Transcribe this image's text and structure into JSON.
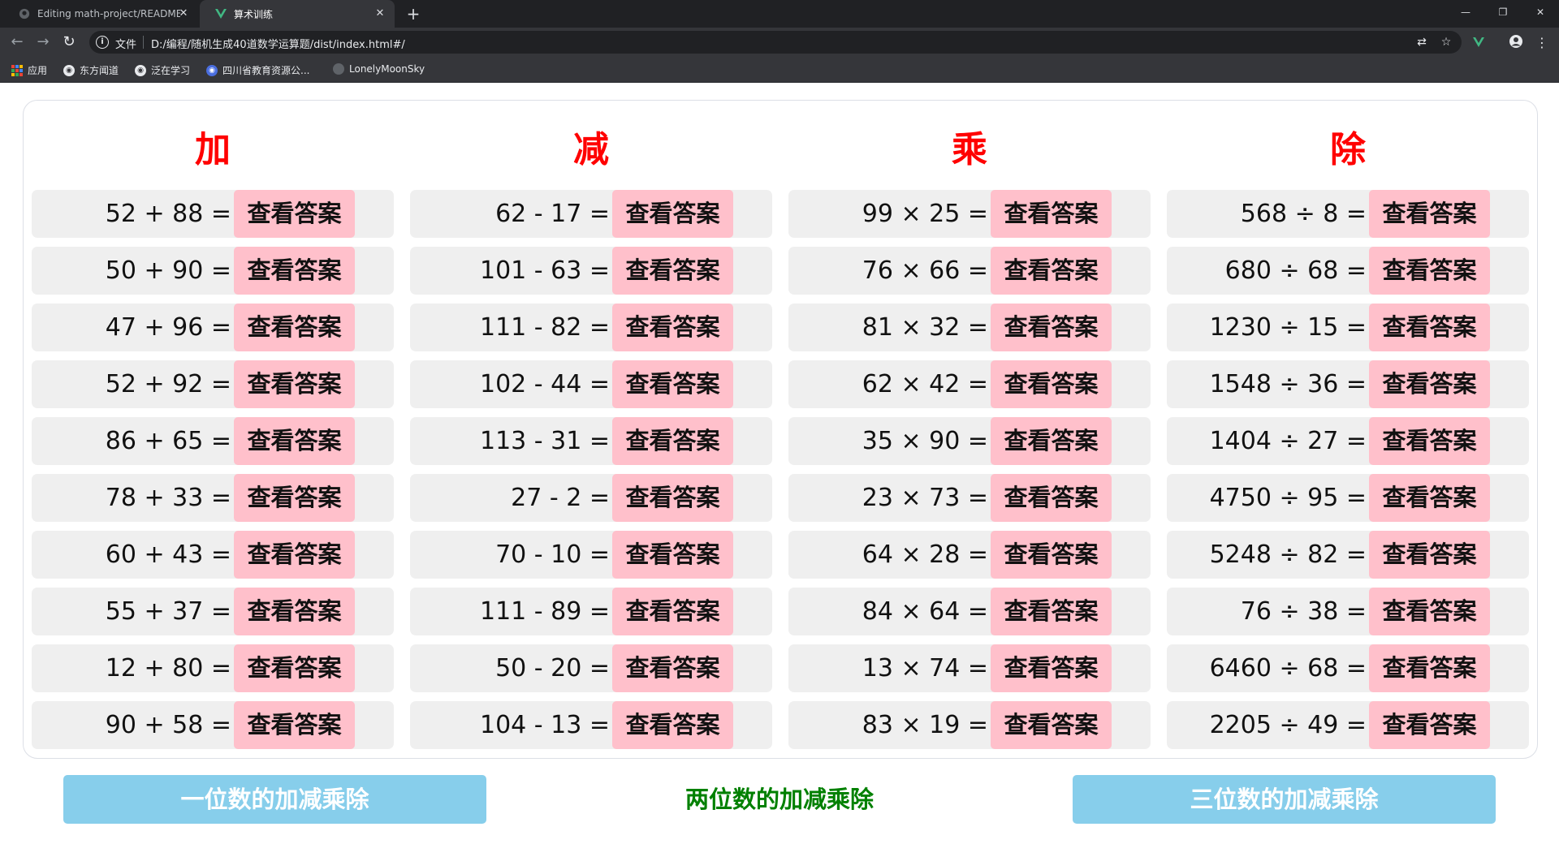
{
  "browser": {
    "tabs": [
      {
        "title": "Editing math-project/README.md",
        "active": false
      },
      {
        "title": "算术训练",
        "active": true
      }
    ],
    "omnibox": {
      "scheme_label": "文件",
      "url": "D:/编程/随机生成40道数学运算题/dist/index.html#/"
    },
    "bookmarks": [
      "应用",
      "东方闻道",
      "泛在学习",
      "四川省教育资源公...",
      "LonelyMoonSky"
    ]
  },
  "page": {
    "answer_label": "查看答案",
    "columns": [
      {
        "title": "加",
        "problems": [
          "52 + 88 =",
          "50 + 90 =",
          "47 + 96 =",
          "52 + 92 =",
          "86 + 65 =",
          "78 + 33 =",
          "60 + 43 =",
          "55 + 37 =",
          "12 + 80 =",
          "90 + 58 ="
        ]
      },
      {
        "title": "减",
        "problems": [
          "62 - 17 =",
          "101 - 63 =",
          "111 - 82 =",
          "102 - 44 =",
          "113 - 31 =",
          "27 - 2 =",
          "70 - 10 =",
          "111 - 89 =",
          "50 - 20 =",
          "104 - 13 ="
        ]
      },
      {
        "title": "乘",
        "problems": [
          "99 × 25 =",
          "76 × 66 =",
          "81 × 32 =",
          "62 × 42 =",
          "35 × 90 =",
          "23 × 73 =",
          "64 × 28 =",
          "84 × 64 =",
          "13 × 74 =",
          "83 × 19 ="
        ]
      },
      {
        "title": "除",
        "problems": [
          "568 ÷ 8 =",
          "680 ÷ 68 =",
          "1230 ÷ 15 =",
          "1548 ÷ 36 =",
          "1404 ÷ 27 =",
          "4750 ÷ 95 =",
          "5248 ÷ 82 =",
          "76 ÷ 38 =",
          "6460 ÷ 68 =",
          "2205 ÷ 49 ="
        ]
      }
    ],
    "level_buttons": {
      "one_digit": "一位数的加减乘除",
      "two_digit": "两位数的加减乘除",
      "three_digit": "三位数的加减乘除"
    }
  },
  "colors": {
    "title_red": "#ff0000",
    "answer_btn": "#ffc0cb",
    "level_btn": "#87ceeb",
    "active_level": "#008000",
    "row_bg": "#efefef"
  }
}
